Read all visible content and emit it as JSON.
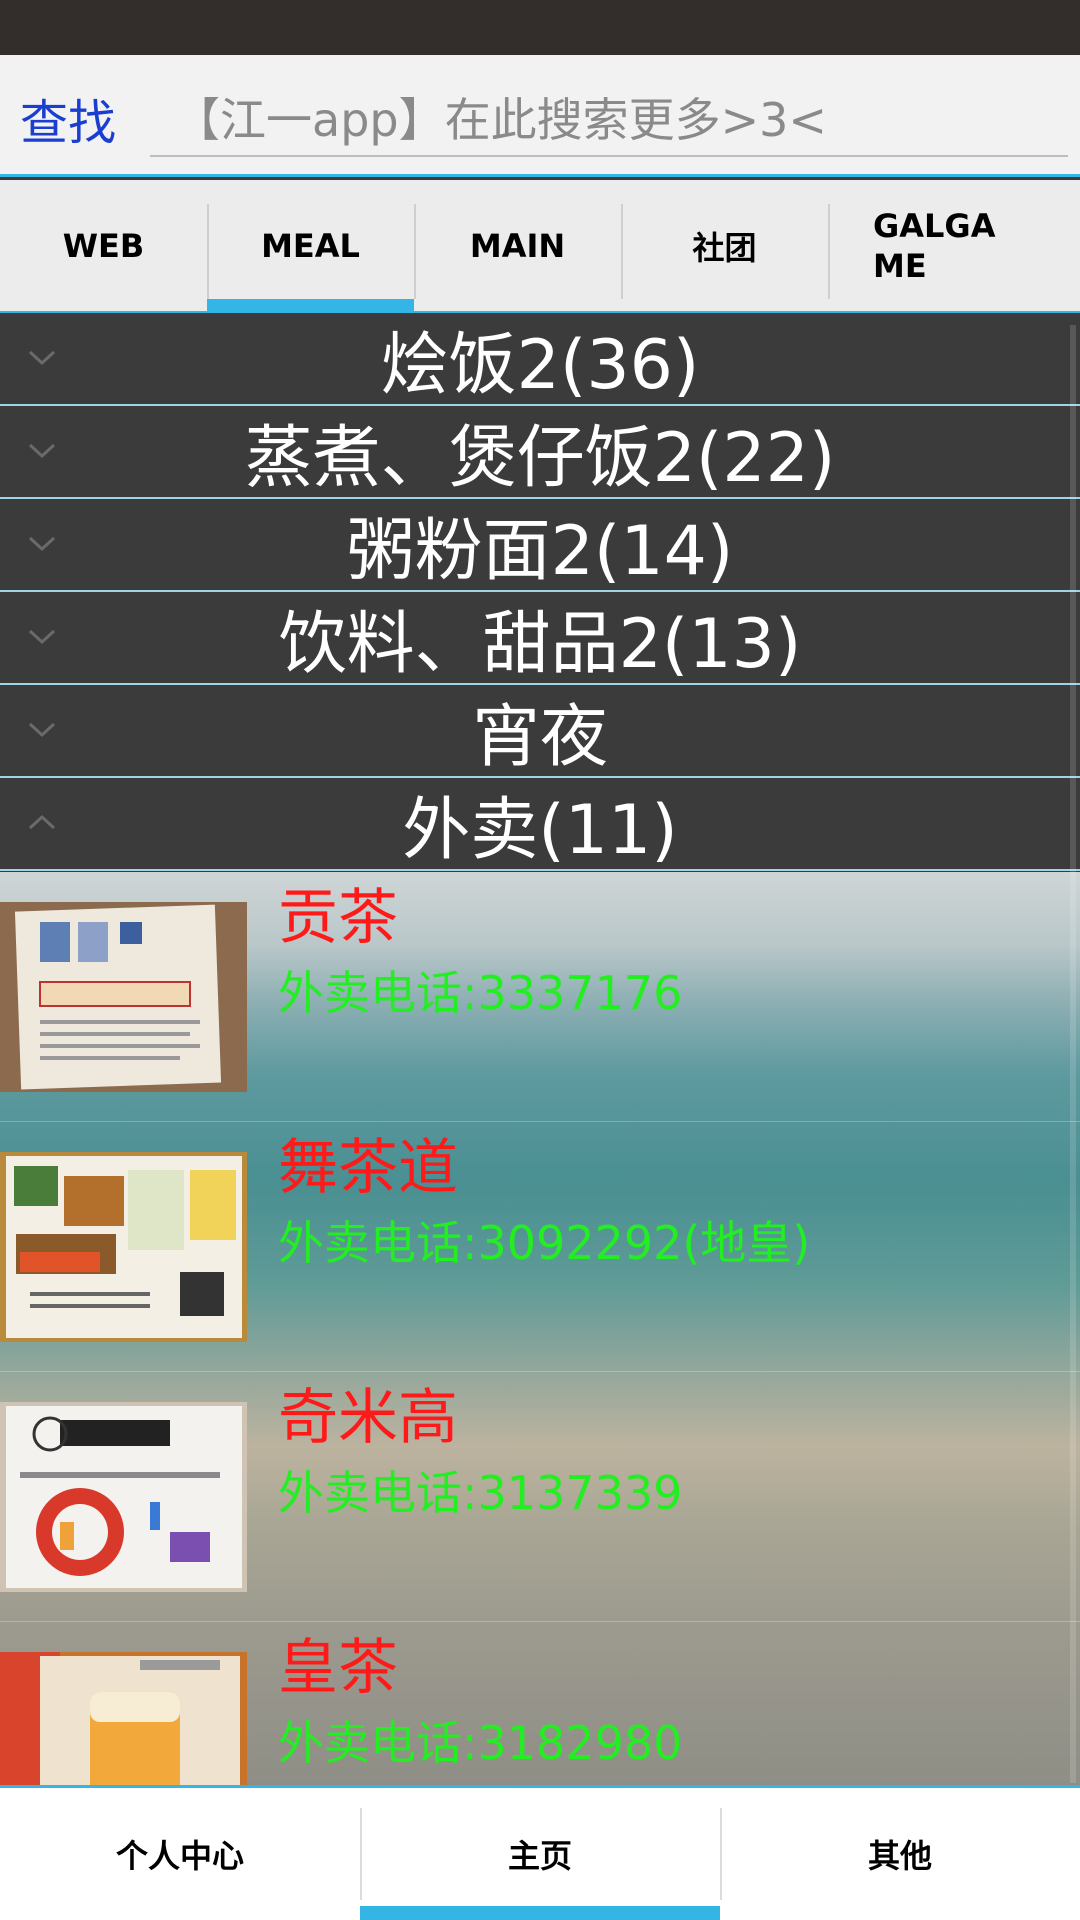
{
  "search": {
    "label": "查找",
    "placeholder": "【江一app】在此搜索更多>3<"
  },
  "tabs": [
    {
      "label": "WEB",
      "active": false
    },
    {
      "label": "MEAL",
      "active": true
    },
    {
      "label": "MAIN",
      "active": false
    },
    {
      "label": "社团",
      "active": false
    },
    {
      "label": "GALGAME",
      "active": false
    }
  ],
  "tab_galgame_line1": "GALGA",
  "tab_galgame_line2": "ME",
  "groups": [
    {
      "title": "烩饭2(36)",
      "expanded": false
    },
    {
      "title": "蒸煮、煲仔饭2(22)",
      "expanded": false
    },
    {
      "title": "粥粉面2(14)",
      "expanded": false
    },
    {
      "title": "饮料、甜品2(13)",
      "expanded": false
    },
    {
      "title": "宵夜",
      "expanded": false
    },
    {
      "title": "外卖(11)",
      "expanded": true
    }
  ],
  "shops": [
    {
      "name": "贡茶",
      "phone": "外卖电话:3337176"
    },
    {
      "name": "舞茶道",
      "phone": "外卖电话:3092292(地皇)"
    },
    {
      "name": "奇米高",
      "phone": "外卖电话:3137339"
    },
    {
      "name": "皇茶",
      "phone": "外卖电话:3182980"
    }
  ],
  "bottom_nav": [
    {
      "label": "个人中心",
      "active": false
    },
    {
      "label": "主页",
      "active": true
    },
    {
      "label": "其他",
      "active": false
    }
  ],
  "colors": {
    "accent": "#33b5e5",
    "shop_name": "#ff1a1a",
    "shop_phone": "#22ee22",
    "search_label": "#1a3fd0"
  }
}
